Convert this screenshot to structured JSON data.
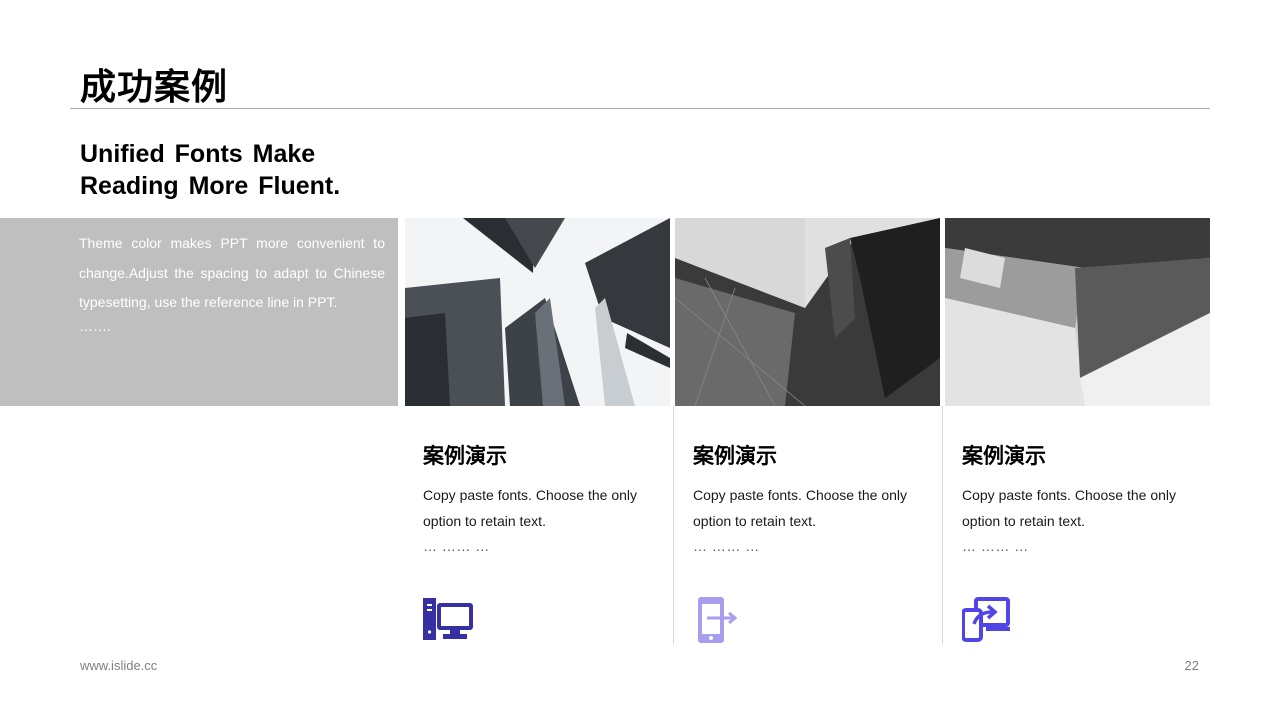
{
  "slide": {
    "title": "成功案例",
    "subtitle": "Unified Fonts Make Reading More Fluent.",
    "intro_text": "Theme color makes PPT more convenient to change.Adjust the spacing to adapt to Chinese typesetting, use the reference line in PPT.",
    "intro_dots": "……."
  },
  "cards": [
    {
      "title": "案例演示",
      "text": "Copy paste fonts. Choose the only option to retain text.",
      "dots": "… …… …",
      "icon": "desktop-computer-icon",
      "icon_color": "#3730a3"
    },
    {
      "title": "案例演示",
      "text": "Copy paste fonts. Choose the only option to retain text.",
      "dots": "… …… …",
      "icon": "mobile-share-icon",
      "icon_color": "#a79ef0"
    },
    {
      "title": "案例演示",
      "text": "Copy paste fonts. Choose the only option to retain text.",
      "dots": "… …… …",
      "icon": "device-sync-icon",
      "icon_color": "#4f46e5"
    }
  ],
  "footer": {
    "website": "www.islide.cc",
    "page_number": "22"
  }
}
